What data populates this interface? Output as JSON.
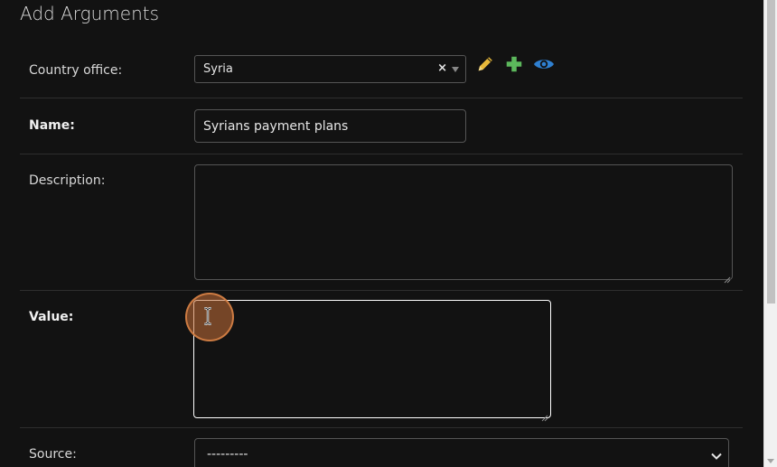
{
  "page": {
    "title": "Add Arguments"
  },
  "fields": {
    "country_office": {
      "label": "Country office:",
      "value": "Syria",
      "clear_symbol": "×",
      "actions": [
        {
          "name": "pencil-icon",
          "color": "#e8b93a"
        },
        {
          "name": "plus-icon",
          "color": "#5cb85c"
        },
        {
          "name": "eye-icon",
          "color": "#2f80d1"
        }
      ]
    },
    "name": {
      "label": "Name:",
      "value": "Syrians payment plans"
    },
    "description": {
      "label": "Description:",
      "value": ""
    },
    "value": {
      "label": "Value:",
      "value": ""
    },
    "source": {
      "label": "Source:",
      "value": "---------"
    }
  }
}
